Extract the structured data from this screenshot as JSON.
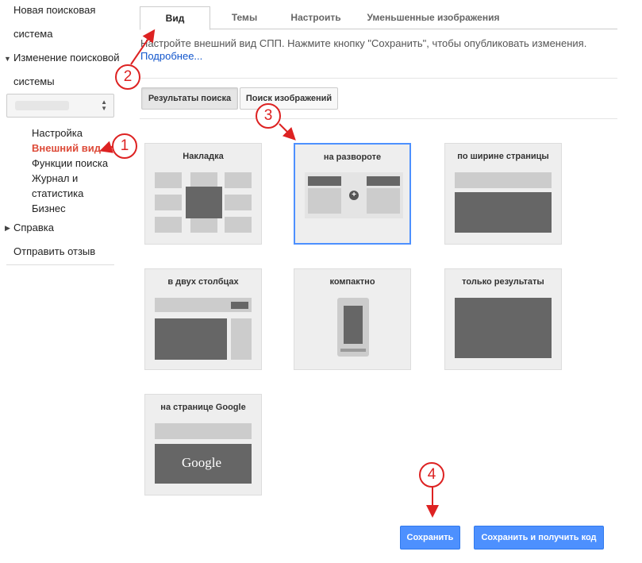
{
  "sidebar": {
    "new_search_engine_line1": "Новая поисковая",
    "new_search_engine_line2": "система",
    "edit_search_engine_line1": "Изменение поисковой",
    "edit_search_engine_line2": "системы",
    "sub_items": [
      "Настройка",
      "Внешний вид",
      "Функции поиска",
      "Журнал и",
      "статистика",
      "Бизнес"
    ],
    "help": "Справка",
    "feedback": "Отправить отзыв"
  },
  "tabs": [
    "Вид",
    "Темы",
    "Настроить",
    "Уменьшенные изображения"
  ],
  "description": "Настройте внешний вид СПП. Нажмите кнопку \"Сохранить\", чтобы опубликовать изменения.",
  "more_link": "Подробнее...",
  "sub_tabs": [
    "Результаты поиска",
    "Поиск изображений"
  ],
  "layouts": [
    "Накладка",
    "на развороте",
    "по ширине страницы",
    "в двух столбцах",
    "компактно",
    "только результаты",
    "на странице Google"
  ],
  "google_logo_text": "Google",
  "buttons": {
    "save": "Сохранить",
    "save_and_get_code": "Сохранить и получить код"
  },
  "annotations": [
    "1",
    "2",
    "3",
    "4"
  ],
  "colors": {
    "accent": "#4d90fe",
    "active_nav": "#dd4b39",
    "annotation": "#dd2222",
    "link": "#1155cc"
  }
}
